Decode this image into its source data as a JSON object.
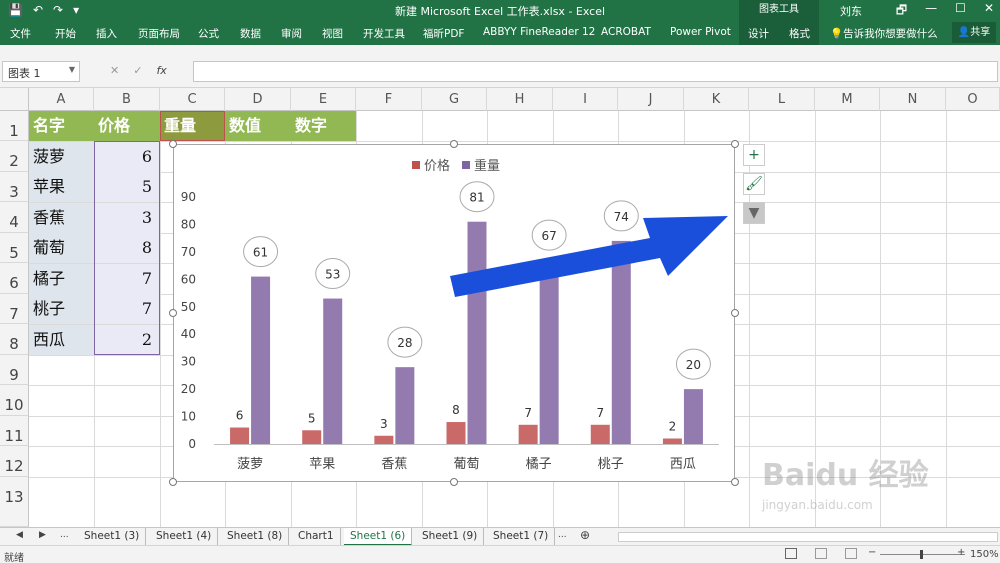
{
  "titlebar": {
    "qat": [
      "💾",
      "↶",
      "↷",
      "▾"
    ],
    "title": "新建 Microsoft Excel 工作表.xlsx  -  Excel",
    "context_group": "图表工具",
    "user": "刘东",
    "window_buttons": [
      "🗗",
      "—",
      "☐",
      "✕"
    ]
  },
  "ribbon": {
    "tabs": [
      "文件",
      "开始",
      "插入",
      "页面布局",
      "公式",
      "数据",
      "审阅",
      "视图",
      "开发工具",
      "福昕PDF",
      "ABBYY FineReader 12",
      "ACROBAT",
      "Power Pivot",
      "设计",
      "格式"
    ],
    "tell_me": "告诉我你想要做什么",
    "share": "共享"
  },
  "formula_bar": {
    "name_box": "图表 1",
    "cancel": "✕",
    "enter": "✓",
    "fx": "fx",
    "value": ""
  },
  "columns": [
    "A",
    "B",
    "C",
    "D",
    "E",
    "F",
    "G",
    "H",
    "I",
    "J",
    "K",
    "L",
    "M",
    "N",
    "O"
  ],
  "rows": [
    "1",
    "2",
    "3",
    "4",
    "5",
    "6",
    "7",
    "8",
    "9",
    "10",
    "11",
    "12",
    "13"
  ],
  "table": {
    "headers": [
      "名字",
      "价格",
      "重量",
      "数值",
      "数字"
    ],
    "names": [
      "菠萝",
      "苹果",
      "香蕉",
      "葡萄",
      "橘子",
      "桃子",
      "西瓜"
    ],
    "prices": [
      6,
      5,
      3,
      8,
      7,
      7,
      2
    ]
  },
  "chart_data": {
    "type": "bar",
    "categories": [
      "菠萝",
      "苹果",
      "香蕉",
      "葡萄",
      "橘子",
      "桃子",
      "西瓜"
    ],
    "series": [
      {
        "name": "价格",
        "values": [
          6,
          5,
          3,
          8,
          7,
          7,
          2
        ],
        "color": "#c0504d"
      },
      {
        "name": "重量",
        "values": [
          61,
          53,
          28,
          81,
          67,
          74,
          20
        ],
        "color": "#8064a2"
      }
    ],
    "ylim": [
      0,
      90
    ],
    "yticks": [
      "0",
      "10",
      "20",
      "30",
      "40",
      "50",
      "60",
      "70",
      "80",
      "90"
    ],
    "legend": "top",
    "grid": false
  },
  "chart_side_buttons": [
    "+",
    "🖌",
    "▼"
  ],
  "sheet_nav": [
    "◀",
    "▶",
    "..."
  ],
  "sheets": [
    {
      "label": "Sheet1 (3)",
      "active": false
    },
    {
      "label": "Sheet1 (4)",
      "active": false
    },
    {
      "label": "Sheet1 (8)",
      "active": false
    },
    {
      "label": "Chart1",
      "active": false
    },
    {
      "label": "Sheet1 (6)",
      "active": true
    },
    {
      "label": "Sheet1 (9)",
      "active": false
    },
    {
      "label": "Sheet1 (7)",
      "active": false
    }
  ],
  "sheet_more": "...",
  "add_sheet": "⊕",
  "status": {
    "left": "就绪",
    "zoom": "150%"
  },
  "watermark": {
    "brand": "Baidu 经验",
    "url": "jingyan.baidu.com"
  },
  "accent": "#217346"
}
